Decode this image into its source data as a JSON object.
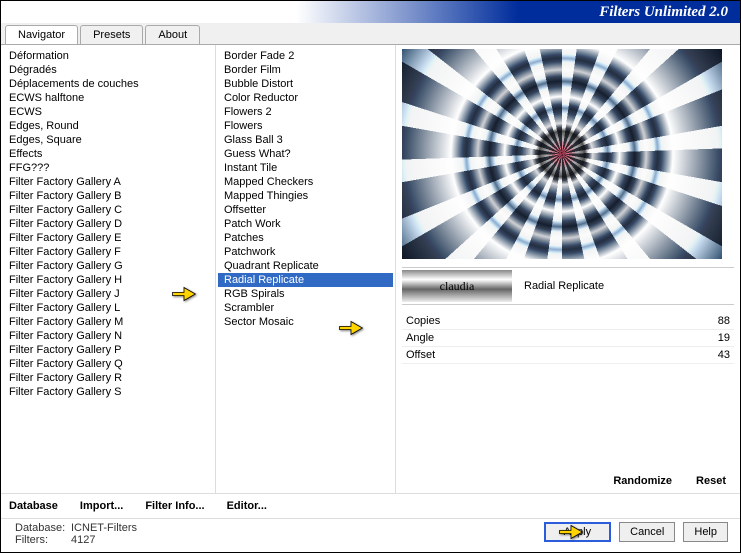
{
  "header": {
    "title": "Filters Unlimited 2.0"
  },
  "tabs": {
    "active": "Navigator",
    "items": [
      "Navigator",
      "Presets",
      "About"
    ]
  },
  "categories": [
    "Déformation",
    "Dégradés",
    "Déplacements de couches",
    "ECWS halftone",
    "ECWS",
    "Edges, Round",
    "Edges, Square",
    "Effects",
    "FFG???",
    "Filter Factory Gallery A",
    "Filter Factory Gallery B",
    "Filter Factory Gallery C",
    "Filter Factory Gallery D",
    "Filter Factory Gallery E",
    "Filter Factory Gallery F",
    "Filter Factory Gallery G",
    "Filter Factory Gallery H",
    "Filter Factory Gallery J",
    "Filter Factory Gallery L",
    "Filter Factory Gallery M",
    "Filter Factory Gallery N",
    "Filter Factory Gallery P",
    "Filter Factory Gallery Q",
    "Filter Factory Gallery R",
    "Filter Factory Gallery S"
  ],
  "categories_selected": "Filter Factory Gallery F",
  "filters": [
    "Border Fade 2",
    "Border Film",
    "Bubble Distort",
    "Color Reductor",
    "Flowers 2",
    "Flowers",
    "Glass Ball 3",
    "Guess What?",
    "Instant Tile",
    "Mapped Checkers",
    "Mapped Thingies",
    "Offsetter",
    "Patch Work",
    "Patches",
    "Patchwork",
    "Quadrant Replicate",
    "Radial Replicate",
    "RGB Spirals",
    "Scrambler",
    "Sector Mosaic"
  ],
  "filters_selected": "Radial Replicate",
  "current_filter": {
    "name": "Radial Replicate",
    "watermark": "claudia"
  },
  "params": [
    {
      "name": "Copies",
      "value": "88"
    },
    {
      "name": "Angle",
      "value": "19"
    },
    {
      "name": "Offset",
      "value": "43"
    }
  ],
  "right_actions": {
    "randomize": "Randomize",
    "reset": "Reset"
  },
  "lower_actions": {
    "database": "Database",
    "import": "Import...",
    "filter_info": "Filter Info...",
    "editor": "Editor..."
  },
  "status": {
    "database_label": "Database:",
    "database_value": "ICNET-Filters",
    "filters_label": "Filters:",
    "filters_value": "4127"
  },
  "buttons": {
    "apply": "Apply",
    "cancel": "Cancel",
    "help": "Help"
  }
}
